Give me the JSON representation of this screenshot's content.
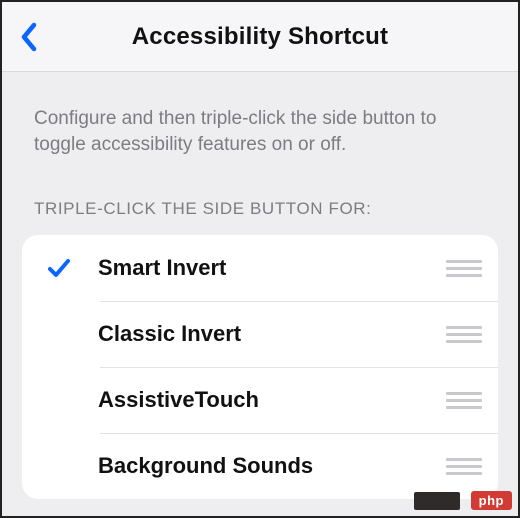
{
  "nav": {
    "title": "Accessibility Shortcut"
  },
  "description": "Configure and then triple-click the side button to toggle accessibility features on or off.",
  "section_header": "TRIPLE-CLICK THE SIDE BUTTON FOR:",
  "items": [
    {
      "label": "Smart Invert",
      "checked": true
    },
    {
      "label": "Classic Invert",
      "checked": false
    },
    {
      "label": "AssistiveTouch",
      "checked": false
    },
    {
      "label": "Background Sounds",
      "checked": false
    }
  ],
  "watermark": "php"
}
